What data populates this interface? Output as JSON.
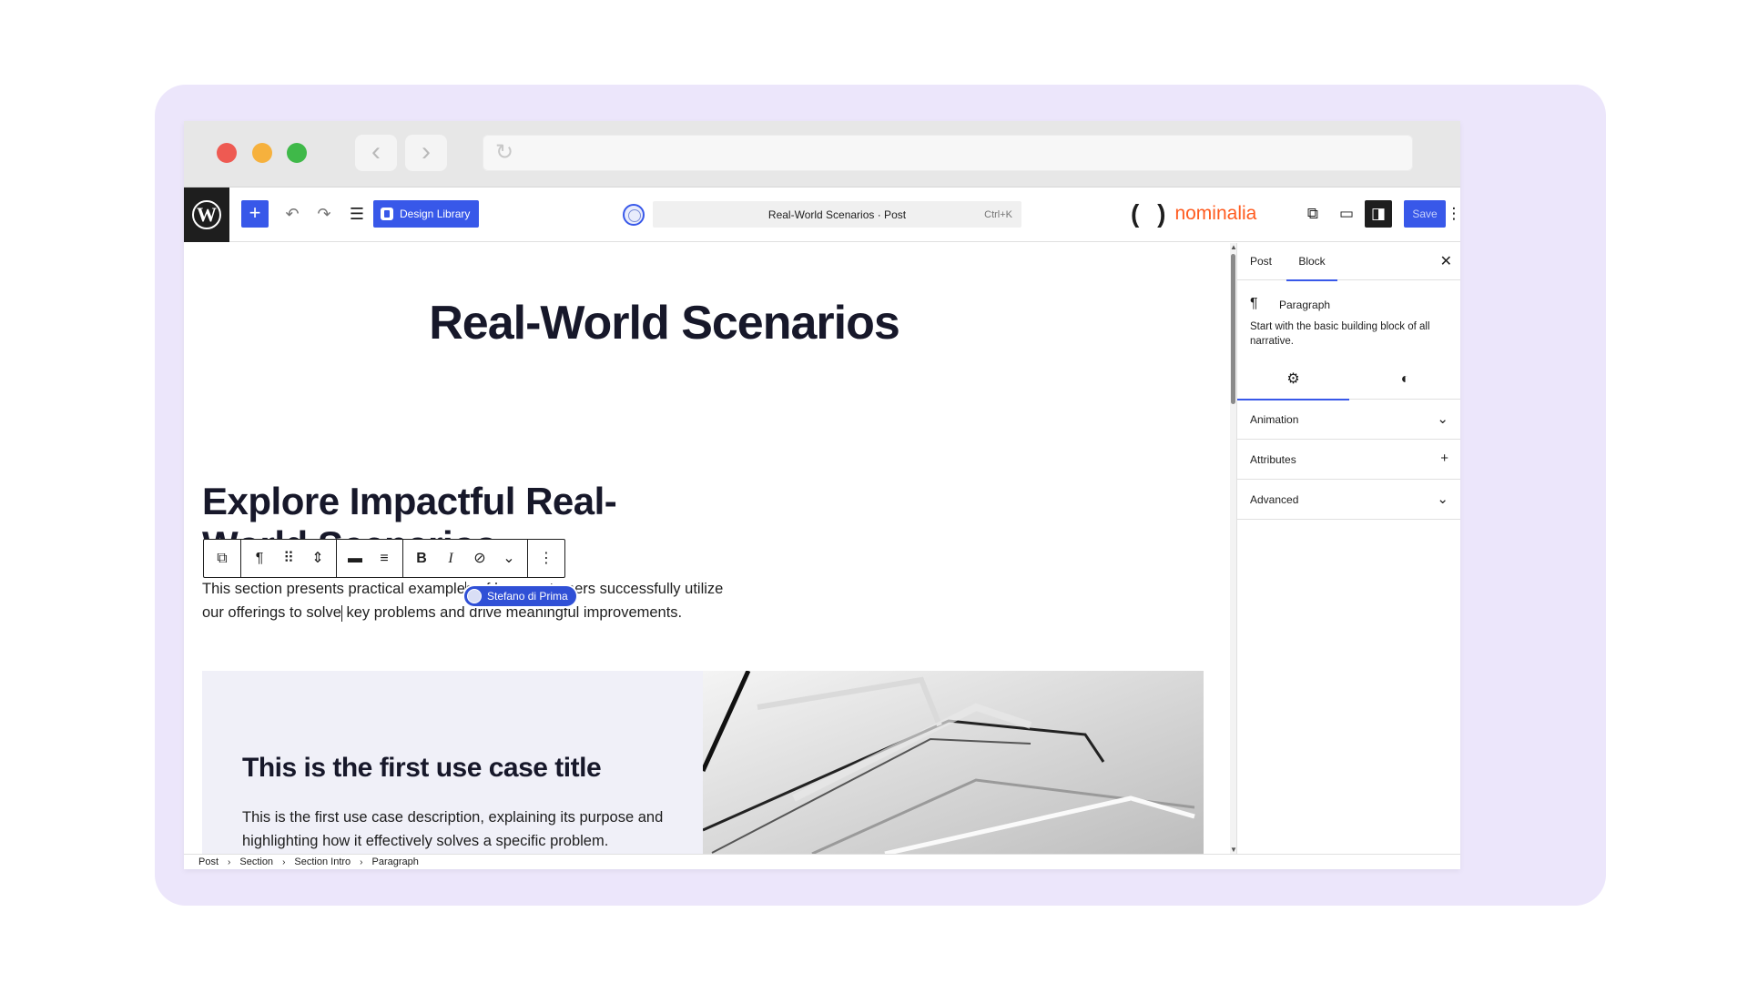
{
  "browser": {
    "back_glyph": "‹",
    "forward_glyph": "›",
    "reload_glyph": "↻"
  },
  "topbar": {
    "wp_logo": "W",
    "add_block": "+",
    "undo_glyph": "↶",
    "redo_glyph": "↷",
    "listview_glyph": "☰",
    "design_library": "Design Library",
    "command_title": "Real-World Scenarios · Post",
    "command_shortcut": "Ctrl+K",
    "brand_paren": "( )",
    "brand_name": "nominalia",
    "view_glyph": "⧉",
    "device_glyph": "▭",
    "settings_glyph": "◨",
    "save": "Save",
    "more_glyph": "⋮"
  },
  "canvas": {
    "title": "Real-World Scenarios",
    "heading": "Explore Impactful Real-World Scenarios",
    "toolbar": {
      "transform": "⧉",
      "paragraph": "¶",
      "drag": "⠿",
      "move": "⇕",
      "align_wide": "▬",
      "align_left": "≡",
      "bold": "B",
      "italic": "I",
      "link": "⊘",
      "more_rich": "⌄",
      "options": "⋮"
    },
    "paragraph_before": "This section presents practical example",
    "paragraph_middle": "s of how customers successfully utilize our offerings to solve",
    "paragraph_after": " key problems and drive meaningful improvements.",
    "collaborator": "Stefano di Prima",
    "usecase_title": "This is the first use case title",
    "usecase_desc": "This is the first use case description, explaining its purpose and highlighting how it effectively solves a specific problem."
  },
  "sidebar": {
    "tab_post": "Post",
    "tab_block": "Block",
    "close": "✕",
    "block_icon": "¶",
    "block_name": "Paragraph",
    "block_desc": "Start with the basic building block of all narrative.",
    "settings_icon": "⚙",
    "styles_icon": "◐",
    "panels": [
      {
        "label": "Animation",
        "icon": "⌄"
      },
      {
        "label": "Attributes",
        "icon": "+"
      },
      {
        "label": "Advanced",
        "icon": "⌄"
      }
    ]
  },
  "breadcrumb": [
    "Post",
    "Section",
    "Section Intro",
    "Paragraph"
  ],
  "breadcrumb_sep": "›",
  "scroll_up": "▲",
  "scroll_down": "▼",
  "colors": {
    "accent": "#3858e9",
    "frame": "#ece6fb",
    "brand": "#ff5b1f",
    "collab": "#3050d6"
  }
}
